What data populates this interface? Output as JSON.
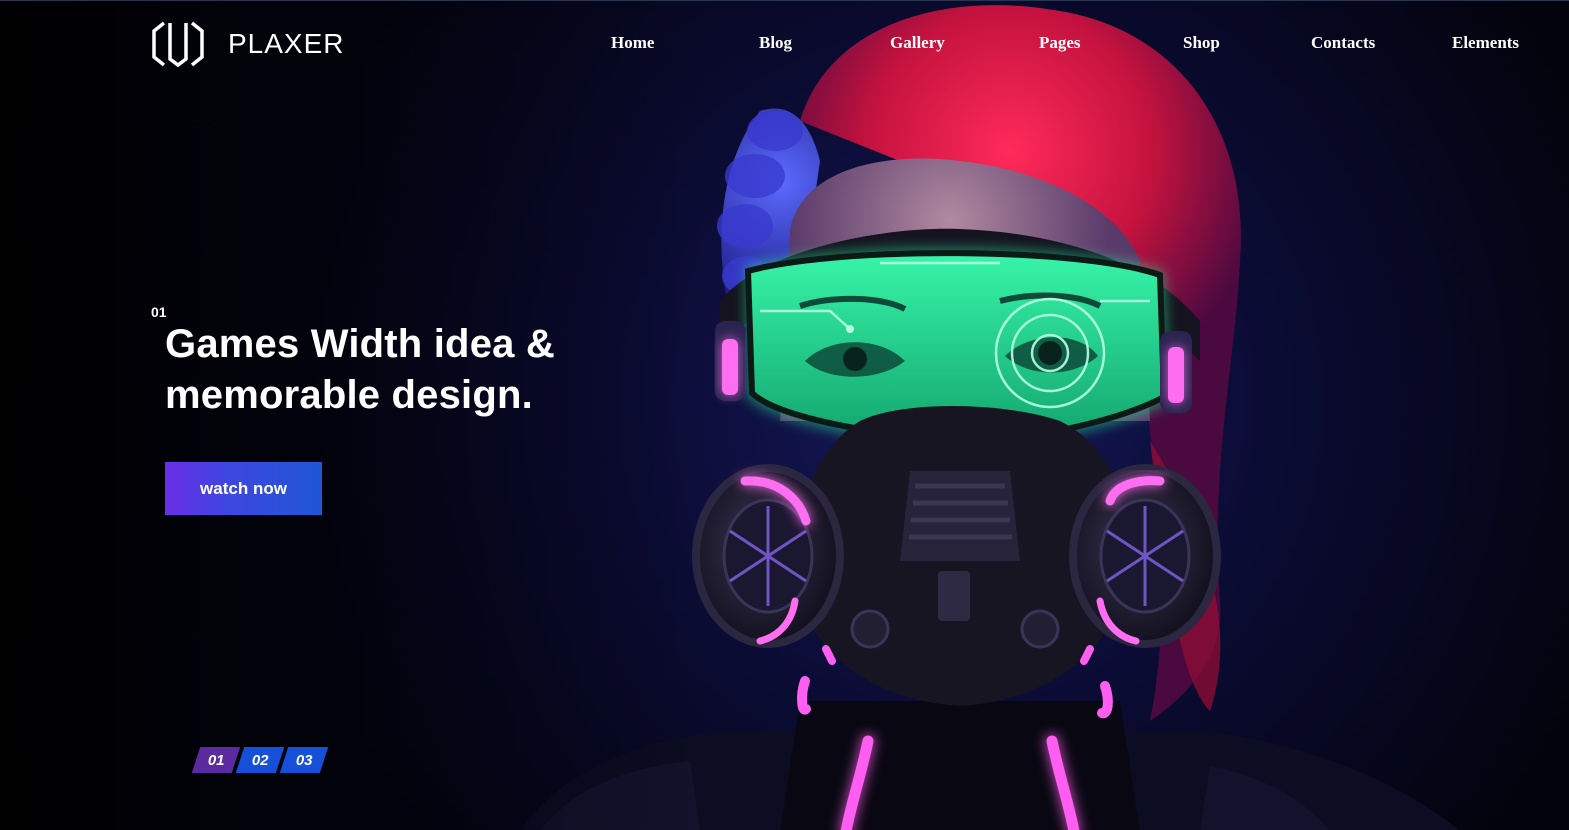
{
  "header": {
    "logo_text": "PLAXER",
    "nav": [
      {
        "label": "Home"
      },
      {
        "label": "Blog"
      },
      {
        "label": "Gallery"
      },
      {
        "label": "Pages"
      },
      {
        "label": "Shop"
      },
      {
        "label": "Contacts"
      },
      {
        "label": "Elements"
      }
    ]
  },
  "hero": {
    "slide_index": "01",
    "title_line1": "Games Width idea &",
    "title_line2": "memorable design.",
    "cta_label": "watch now",
    "background_icon": "cyberpunk-gas-mask-character-image"
  },
  "pager": {
    "items": [
      "01",
      "02",
      "03"
    ],
    "active": "01"
  },
  "colors": {
    "background": "#03030c",
    "cta_gradient_start": "#6a2ee6",
    "cta_gradient_end": "#1d56d4",
    "pager_active": "#5a2a9e",
    "pager_inactive": "#1650d8",
    "visor_green": "#23e89a",
    "neon_pink": "#ff4fe6",
    "hair_red": "#d01a4a"
  }
}
